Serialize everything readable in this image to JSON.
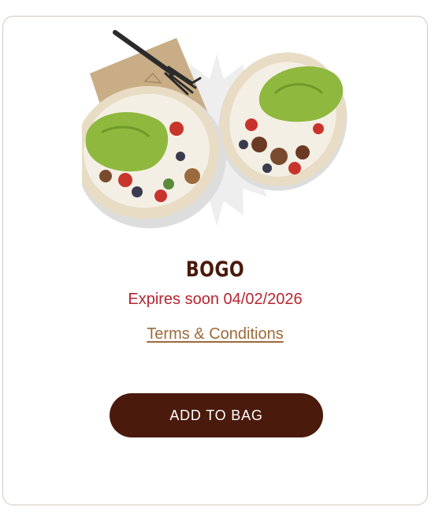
{
  "offer": {
    "title": "BOGO",
    "expiry_text": "Expires soon 04/02/2026",
    "terms_label": "Terms & Conditions",
    "add_button_label": "ADD TO BAG"
  },
  "colors": {
    "title": "#4a1a0c",
    "expiry": "#b6262f",
    "terms_link": "#9b6a39",
    "button_bg": "#4a1a0c",
    "button_text": "#ffffff",
    "card_border": "#cfc8c0"
  },
  "image": {
    "icon": "burrito-bowls-image"
  }
}
